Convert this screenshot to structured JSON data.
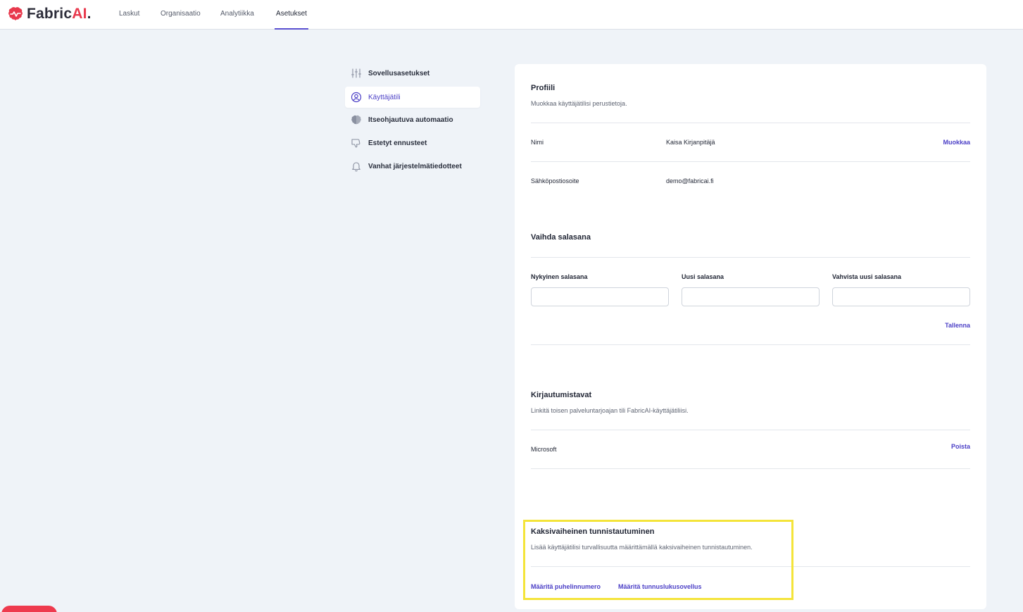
{
  "brand": {
    "name_main": "Fabric",
    "name_accent": "AI",
    "name_dot": "."
  },
  "nav": {
    "tabs": [
      {
        "label": "Laskut"
      },
      {
        "label": "Organisaatio"
      },
      {
        "label": "Analytiikka"
      },
      {
        "label": "Asetukset",
        "active": true
      }
    ]
  },
  "sidebar": {
    "items": [
      {
        "label": "Sovellusasetukset",
        "icon": "sliders-icon"
      },
      {
        "label": "Käyttäjätili",
        "icon": "user-circle-icon",
        "active": true
      },
      {
        "label": "Itseohjautuva automaatio",
        "icon": "brain-icon"
      },
      {
        "label": "Estetyt ennusteet",
        "icon": "thumbs-down-icon"
      },
      {
        "label": "Vanhat järjestelmätiedotteet",
        "icon": "bell-icon"
      }
    ]
  },
  "profile": {
    "title": "Profiili",
    "subtitle": "Muokkaa käyttäjätilisi perustietoja.",
    "name_label": "Nimi",
    "name_value": "Kaisa Kirjanpitäjä",
    "edit_label": "Muokkaa",
    "email_label": "Sähköpostiosoite",
    "email_value": "demo@fabricai.fi"
  },
  "password": {
    "title": "Vaihda salasana",
    "current_label": "Nykyinen salasana",
    "new_label": "Uusi salasana",
    "confirm_label": "Vahvista uusi salasana",
    "save_label": "Tallenna"
  },
  "logins": {
    "title": "Kirjautumistavat",
    "subtitle": "Linkitä toisen palveluntarjoajan tili FabricAI-käyttäjätiliisi.",
    "provider": "Microsoft",
    "remove_label": "Poista"
  },
  "twofa": {
    "title": "Kaksivaiheinen tunnistautuminen",
    "subtitle": "Lisää käyttäjätilisi turvallisuutta määrittämällä kaksivaiheinen tunnistautuminen.",
    "phone_label": "Määritä puhelinnumero",
    "app_label": "Määritä tunnuslukusovellus"
  },
  "colors": {
    "accent": "#4b3fc6",
    "brand": "#e8394d",
    "highlight": "#f4e43a"
  }
}
